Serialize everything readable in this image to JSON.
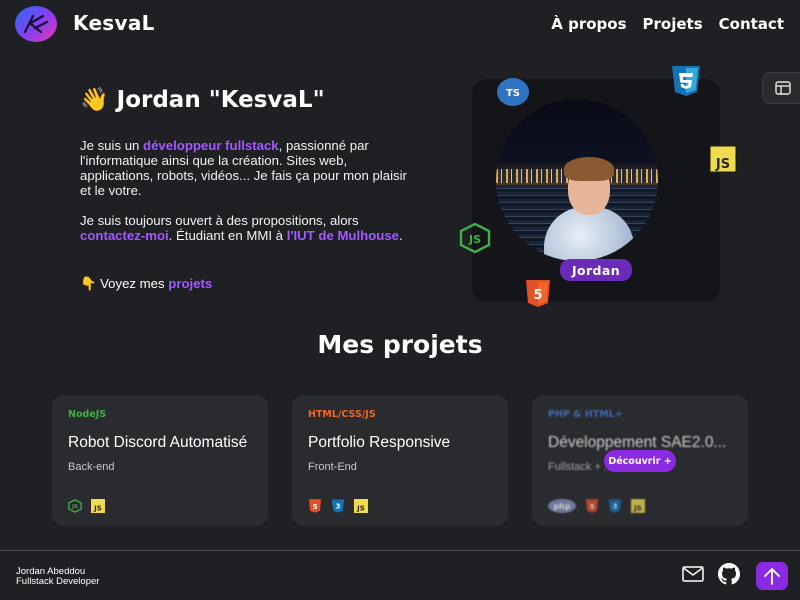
{
  "brand": {
    "name": "KesvaL",
    "logo_icon": "kesval-logo-icon"
  },
  "nav": [
    {
      "label": "À propos"
    },
    {
      "label": "Projets"
    },
    {
      "label": "Contact"
    }
  ],
  "intro": {
    "wave": "👋",
    "title": "Jordan \"KesvaL\"",
    "bio1_pre": "Je suis un ",
    "bio1_hl": "développeur fullstack",
    "bio1_post": ", passionné par l'informatique ainsi que la création. Sites web, applications, robots, vidéos... Je fais ça pour mon plaisir et le votre.",
    "bio2_pre": "Je suis toujours ouvert à des propositions, alors ",
    "bio2_hl1": "contactez-moi",
    "bio2_mid": ". Étudiant en MMI à ",
    "bio2_hl2": "l'IUT de Mulhouse",
    "bio2_post": ".",
    "pointer": "👇",
    "projects_pre": "Voyez mes ",
    "projects_link": "projets"
  },
  "profile": {
    "name": "Jordan",
    "badges": {
      "ts": "TS",
      "css": "CSS3",
      "js": "JS",
      "node": "JS",
      "html": "5"
    }
  },
  "projects": {
    "title": "Mes projets",
    "cards": [
      {
        "tag": "NodeJS",
        "tag_color": "#3fae49",
        "title": "Robot Discord Automatisé",
        "sub": "Back-end",
        "icons": [
          "nodejs-icon",
          "javascript-icon"
        ]
      },
      {
        "tag": "HTML/CSS/JS",
        "tag_color": "#f06529",
        "title": "Portfolio Responsive",
        "sub": "Front-End",
        "icons": [
          "html5-icon",
          "css3-icon",
          "javascript-icon"
        ]
      },
      {
        "tag": "PHP & HTML+",
        "tag_color": "#4a7bd8",
        "title": "Développement SAE2.0...",
        "sub": "Fullstack + ...",
        "icons": [
          "php-icon",
          "html5-icon",
          "css3-icon",
          "javascript-icon"
        ],
        "button": "Découvrir +"
      }
    ]
  },
  "footer": {
    "name": "Jordan Abeddou",
    "role": "Fullstack Developer",
    "icons": [
      "mail-icon",
      "github-icon",
      "arrow-up-icon"
    ]
  },
  "colors": {
    "accent": "#a259ff",
    "button": "#8a2be2",
    "bg": "#1f2023",
    "card": "#2a2b2f"
  }
}
